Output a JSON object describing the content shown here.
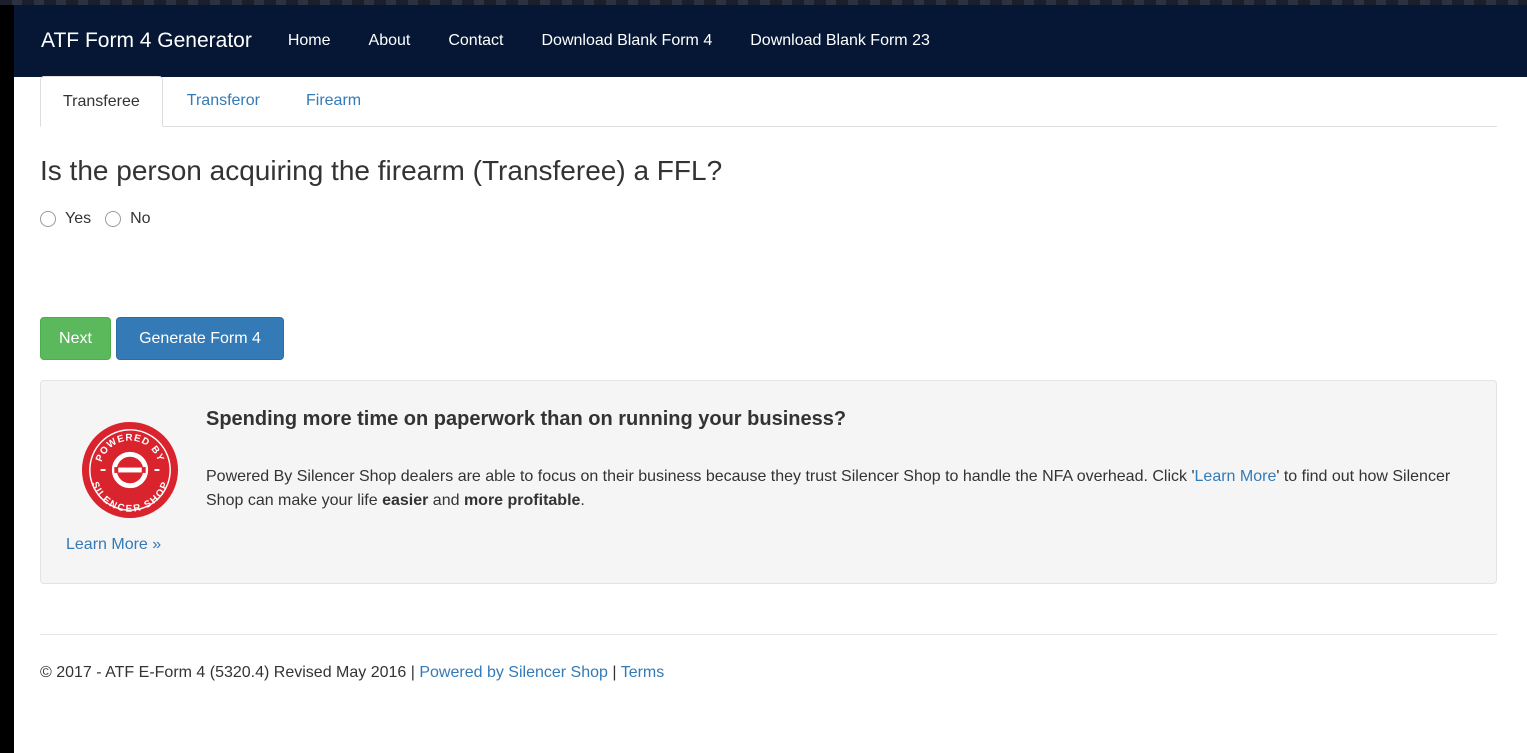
{
  "nav": {
    "brand": "ATF Form 4 Generator",
    "links": [
      "Home",
      "About",
      "Contact",
      "Download Blank Form 4",
      "Download Blank Form 23"
    ]
  },
  "tabs": [
    {
      "label": "Transferee",
      "active": true
    },
    {
      "label": "Transferor",
      "active": false
    },
    {
      "label": "Firearm",
      "active": false
    }
  ],
  "question": "Is the person acquiring the firearm (Transferee) a FFL?",
  "options": [
    {
      "label": "Yes",
      "checked": false
    },
    {
      "label": "No",
      "checked": false
    }
  ],
  "buttons": {
    "next": "Next",
    "generate": "Generate Form 4"
  },
  "promo": {
    "logo_text_top": "POWERED BY",
    "logo_text_bottom": "SILENCER SHOP",
    "title": "Spending more time on paperwork than on running your business?",
    "text_1": "Powered By Silencer Shop dealers are able to focus on their business because they trust Silencer Shop to handle the NFA overhead. Click '",
    "text_link": "Learn More",
    "text_2": "' to find out how Silencer Shop can make your life ",
    "bold_1": "easier",
    "text_3": " and ",
    "bold_2": "more profitable",
    "text_4": ".",
    "learn_more": "Learn More »"
  },
  "footer": {
    "text": "© 2017 - ATF E-Form 4 (5320.4) Revised May 2016 | ",
    "link1": "Powered by Silencer Shop",
    "sep": " | ",
    "link2": "Terms"
  },
  "colors": {
    "navbar": "#051735",
    "primary": "#337ab7",
    "success": "#5cb85c",
    "logo_red": "#d9232d"
  }
}
